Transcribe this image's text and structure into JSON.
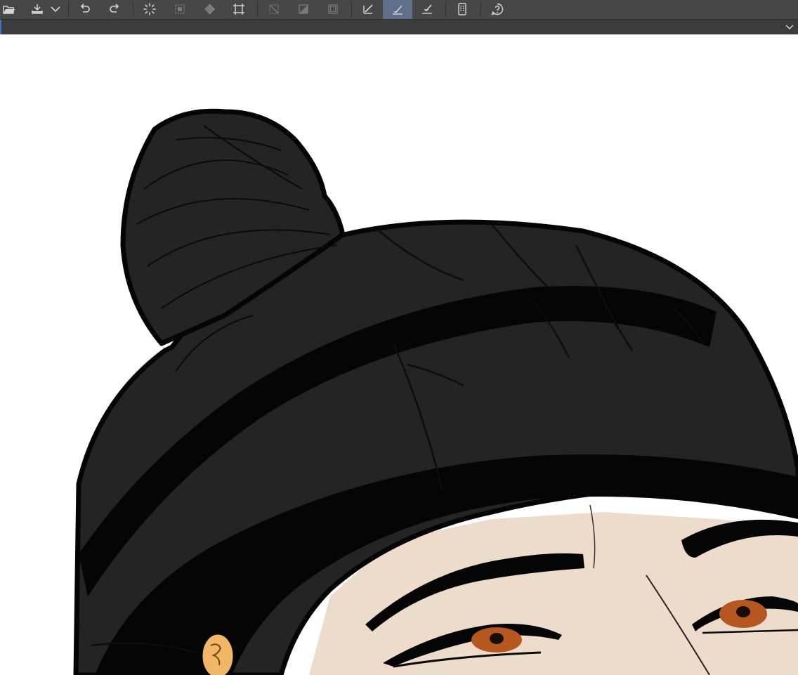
{
  "toolbar": {
    "items": [
      {
        "icon": "open-folder-icon",
        "state": "normal"
      },
      {
        "icon": "save-icon",
        "state": "normal"
      },
      {
        "icon": "save-dropdown-chevron-icon",
        "state": "normal"
      },
      {
        "icon": "undo-icon",
        "state": "normal"
      },
      {
        "icon": "redo-icon",
        "state": "normal"
      },
      {
        "icon": "loading-spinner-icon",
        "state": "normal"
      },
      {
        "icon": "clear-selection-icon",
        "state": "disabled"
      },
      {
        "icon": "fill-icon",
        "state": "disabled"
      },
      {
        "icon": "transform-crop-icon",
        "state": "normal"
      },
      {
        "icon": "deselect-icon",
        "state": "disabled"
      },
      {
        "icon": "invert-selection-icon",
        "state": "disabled"
      },
      {
        "icon": "selection-border-icon",
        "state": "disabled"
      },
      {
        "icon": "ruler-snap-icon",
        "state": "normal"
      },
      {
        "icon": "brush-snap-icon",
        "state": "active"
      },
      {
        "icon": "special-ruler-icon",
        "state": "normal"
      },
      {
        "icon": "smartphone-icon",
        "state": "normal"
      },
      {
        "icon": "help-icon",
        "state": "normal"
      }
    ]
  },
  "subbar": {
    "icon": "chevron-down-icon"
  },
  "colors": {
    "toolbar_bg": "#474747",
    "subbar_bg": "#3b3b3b",
    "active_bg": "#5f6f8c",
    "icon": "#d6d6d6",
    "icon_disabled": "#7a7a7a",
    "hat": "#242424",
    "outline": "#050505",
    "skin": "#eddccb",
    "iris": "#b5571f",
    "earring": "#f2b766"
  }
}
